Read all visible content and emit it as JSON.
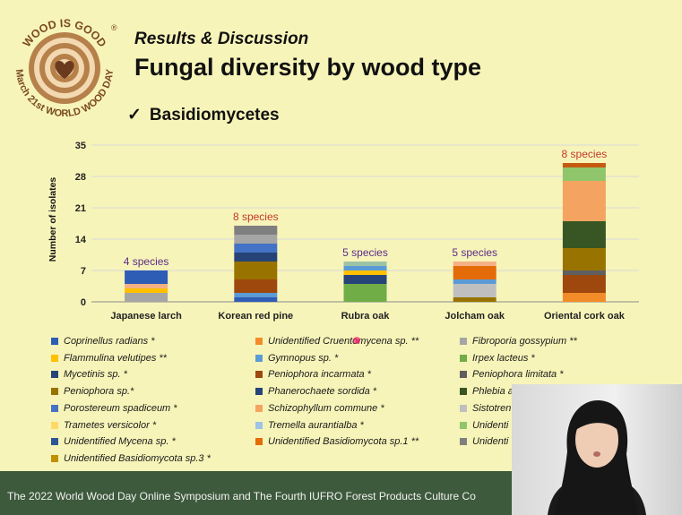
{
  "logo": {
    "top_text": "WOOD IS GOOD",
    "registered": "®",
    "bottom_text": "March 21st WORLD WOOD DAY",
    "icon": "heart-icon"
  },
  "header": {
    "subtitle": "Results & Discussion",
    "title": "Fungal diversity by wood type",
    "bullet_mark": "✓",
    "bullet": "Basidiomycetes"
  },
  "chart_data": {
    "type": "bar",
    "stacked": true,
    "ylabel": "Number of isolates",
    "ylim": [
      0,
      35
    ],
    "yticks": [
      0,
      7,
      14,
      21,
      28,
      35
    ],
    "grid": true,
    "categories": [
      "Japanese larch",
      "Korean red pine",
      "Rubra oak",
      "Jolcham oak",
      "Oriental cork oak"
    ],
    "annotations": [
      {
        "text": "4 species",
        "color": "#5b2c8a"
      },
      {
        "text": "8 species",
        "color": "#c0392b"
      },
      {
        "text": "5 species",
        "color": "#5b2c8a"
      },
      {
        "text": "5 species",
        "color": "#5b2c8a"
      },
      {
        "text": "8 species",
        "color": "#c0392b"
      }
    ],
    "stacks": [
      [
        {
          "value": 2,
          "color": "#a5a5a5"
        },
        {
          "value": 1,
          "color": "#ffc000"
        },
        {
          "value": 1,
          "color": "#f4b183"
        },
        {
          "value": 3,
          "color": "#2e5db6"
        }
      ],
      [
        {
          "value": 1,
          "color": "#2e5db6"
        },
        {
          "value": 1,
          "color": "#5b9bd5"
        },
        {
          "value": 3,
          "color": "#9e480e"
        },
        {
          "value": 4,
          "color": "#997300"
        },
        {
          "value": 2,
          "color": "#264478"
        },
        {
          "value": 2,
          "color": "#4472c4"
        },
        {
          "value": 2,
          "color": "#a5a5a5"
        },
        {
          "value": 2,
          "color": "#7f7f7f"
        }
      ],
      [
        {
          "value": 4,
          "color": "#70ad47"
        },
        {
          "value": 2,
          "color": "#264478"
        },
        {
          "value": 1,
          "color": "#ffc000"
        },
        {
          "value": 1,
          "color": "#5b9bd5"
        },
        {
          "value": 1,
          "color": "#9dc3a6"
        }
      ],
      [
        {
          "value": 1,
          "color": "#997300"
        },
        {
          "value": 3,
          "color": "#bfbfbf"
        },
        {
          "value": 1,
          "color": "#5b9bd5"
        },
        {
          "value": 3,
          "color": "#e36c09"
        },
        {
          "value": 1,
          "color": "#f4b183"
        }
      ],
      [
        {
          "value": 2,
          "color": "#f28c28"
        },
        {
          "value": 4,
          "color": "#9e480e"
        },
        {
          "value": 1,
          "color": "#5f5f5f"
        },
        {
          "value": 5,
          "color": "#997300"
        },
        {
          "value": 6,
          "color": "#375623"
        },
        {
          "value": 9,
          "color": "#f4a460"
        },
        {
          "value": 3,
          "color": "#8fc66b"
        },
        {
          "value": 1,
          "color": "#c55a11"
        }
      ]
    ],
    "legend_placement": "bottom",
    "legend": [
      {
        "name": "Coprinellus radians *",
        "color": "#2e5db6"
      },
      {
        "name": "Unidentified Cruentomycena sp. **",
        "color": "#f28c28"
      },
      {
        "name": "Fibroporia gossypium **",
        "color": "#a5a5a5"
      },
      {
        "name": "Flammulina velutipes **",
        "color": "#ffc000"
      },
      {
        "name": "Gymnopus sp. *",
        "color": "#5b9bd5"
      },
      {
        "name": "Irpex lacteus *",
        "color": "#70ad47"
      },
      {
        "name": "Mycetinis sp. *",
        "color": "#264478"
      },
      {
        "name": "Peniophora incarmata *",
        "color": "#9e480e"
      },
      {
        "name": "Peniophora limitata *",
        "color": "#5f5f5f"
      },
      {
        "name": "Peniophora sp.*",
        "color": "#997300"
      },
      {
        "name": "Phanerochaete sordida *",
        "color": "#264478"
      },
      {
        "name": "Phlebia a",
        "color": "#375623"
      },
      {
        "name": "Porostereum spadiceum *",
        "color": "#4472c4"
      },
      {
        "name": "Schizophyllum commune *",
        "color": "#f4a460"
      },
      {
        "name": "Sistotren",
        "color": "#bfbfbf"
      },
      {
        "name": "Trametes versicolor *",
        "color": "#ffd966"
      },
      {
        "name": "Tremella aurantialba *",
        "color": "#9dc3e6"
      },
      {
        "name": "Unidenti",
        "color": "#8fc66b"
      },
      {
        "name": "Unidentified Mycena sp. *",
        "color": "#2f5597"
      },
      {
        "name": "Unidentified Basidiomycota sp.1 **",
        "color": "#e36c09"
      },
      {
        "name": "Unidenti",
        "color": "#7f7f7f"
      },
      {
        "name": "Unidentified Basidiomycota sp.3 *",
        "color": "#bf9000"
      }
    ]
  },
  "footer": {
    "text": "The 2022 World Wood Day Online Symposium and The Fourth IUFRO Forest Products Culture Co"
  },
  "webcam": {
    "label": "presenter-video"
  }
}
